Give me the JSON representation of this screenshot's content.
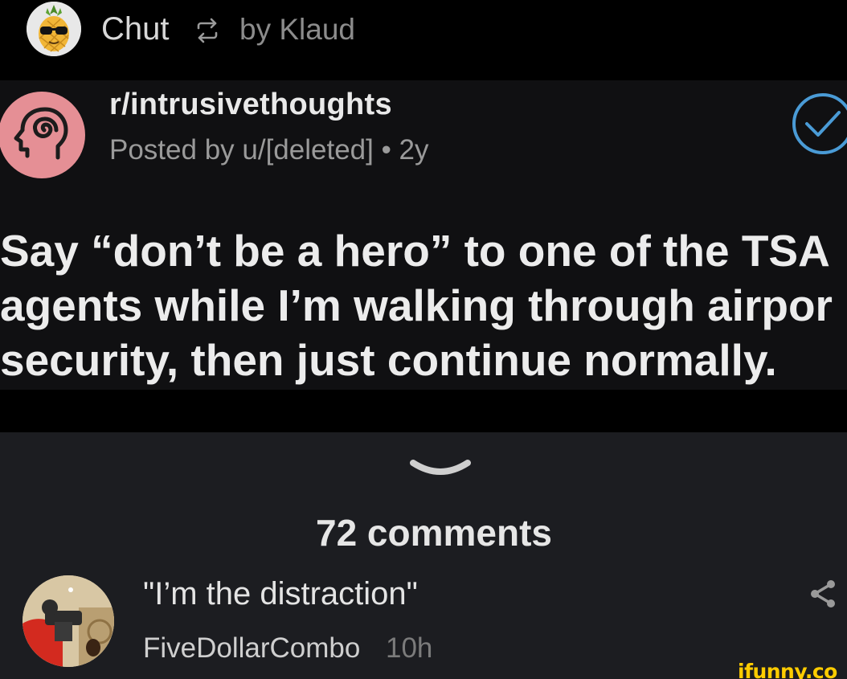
{
  "repost": {
    "user_name": "Chut",
    "by_text": "by Klaud",
    "avatar_icon": "pineapple-sunglasses-avatar",
    "repost_icon": "repost-icon"
  },
  "post": {
    "subreddit": "r/intrusivethoughts",
    "meta": "Posted by u/[deleted] • 2y",
    "subreddit_icon": "head-spiral-icon",
    "subreddit_icon_color": "#e58f95",
    "check_icon": "check-circle-icon",
    "check_color": "#4a9bd6",
    "title_lines": [
      "Say “don’t be a hero” to one of the TSA",
      "agents while I’m walking through airpor",
      "security, then just continue normally."
    ]
  },
  "comments": {
    "expand_icon": "chevron-down-icon",
    "count_label": "72 comments",
    "items": [
      {
        "text": "\"I’m the distraction\"",
        "author": "FiveDollarCombo",
        "time": "10h",
        "share_icon": "share-icon"
      }
    ]
  },
  "watermark": {
    "text": "ifunny.co",
    "color": "#ffcc00"
  },
  "colors": {
    "background": "#000000",
    "card_background": "#101012",
    "comments_background": "#1c1d21"
  }
}
